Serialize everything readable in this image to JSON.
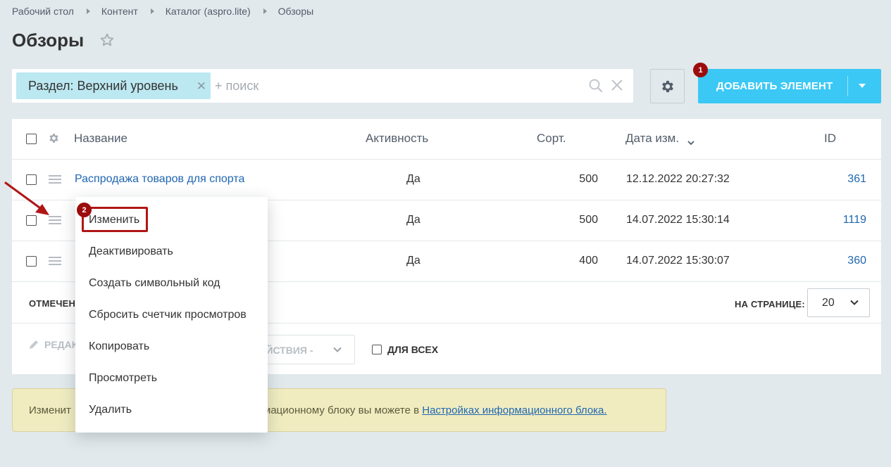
{
  "breadcrumb": [
    "Рабочий стол",
    "Контент",
    "Каталог (aspro.lite)",
    "Обзоры"
  ],
  "page_title": "Обзоры",
  "filter": {
    "chip_label": "Раздел: Верхний уровень",
    "placeholder": "+ поиск"
  },
  "toolbar": {
    "add_label": "ДОБАВИТЬ ЭЛЕМЕНТ",
    "badge_1": "1",
    "badge_2": "2"
  },
  "table": {
    "columns": [
      "Название",
      "Активность",
      "Сорт.",
      "Дата изм.",
      "ID"
    ],
    "rows": [
      {
        "name": "Распродажа товаров для спорта",
        "active": "Да",
        "sort": "500",
        "date": "12.12.2022 20:27:32",
        "id": "361"
      },
      {
        "name": "",
        "active": "Да",
        "sort": "500",
        "date": "14.07.2022 15:30:14",
        "id": "1119"
      },
      {
        "name": "",
        "active": "Да",
        "sort": "400",
        "date": "14.07.2022 15:30:07",
        "id": "360"
      }
    ]
  },
  "footer": {
    "checked_label": "ОТМЕЧЕН",
    "per_page_label": "НА СТРАНИЦЕ:",
    "per_page_value": "20",
    "edit_label": "РЕДАК",
    "actions_label": "ЕЙСТВИЯ -",
    "for_all_label": "ДЛЯ ВСЕХ"
  },
  "info": {
    "text_start": "Изменит",
    "text_middle": "мационному блоку вы можете в",
    "link": "Настройках информационного блока."
  },
  "context_menu": {
    "items": [
      "Изменить",
      "Деактивировать",
      "Создать символьный код",
      "Сбросить счетчик просмотров",
      "Копировать",
      "Просмотреть",
      "Удалить"
    ]
  },
  "colors": {
    "accent": "#3bc8f5",
    "chip": "#bce8f1",
    "link": "#2067b0",
    "annotation": "#b01616",
    "background": "#e1e9ec"
  }
}
